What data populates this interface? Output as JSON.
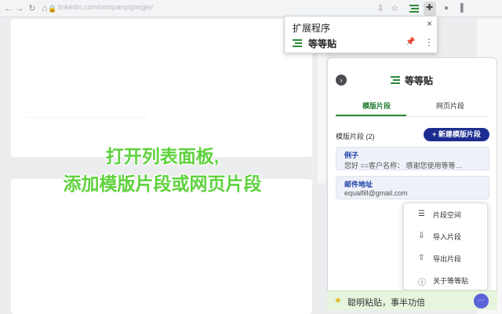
{
  "browser": {
    "url": "linkedin.com/company/google/"
  },
  "extensions_popup": {
    "title": "扩展程序",
    "extension_name": "等等贴",
    "close_glyph": "×",
    "pin_glyph": "📌",
    "more_glyph": "⋮"
  },
  "panel": {
    "brand": "等等贴",
    "back_glyph": "›",
    "tabs": [
      {
        "label": "模版片段",
        "active": true
      },
      {
        "label": "网页片段",
        "active": false
      }
    ],
    "section_label": "模版片段 (2)",
    "new_button": "+ 新建模版片段",
    "items": [
      {
        "title": "例子",
        "body": "您好 ==客户名称：  感谢您使用等等…"
      },
      {
        "title": "邮件地址",
        "body": "equalfill@gmail.com"
      }
    ],
    "menu": [
      {
        "icon": "sliders-icon",
        "glyph": "☰",
        "label": "片段空间"
      },
      {
        "icon": "import-icon",
        "glyph": "⇩",
        "label": "导入片段"
      },
      {
        "icon": "export-icon",
        "glyph": "⇧",
        "label": "导出片段"
      },
      {
        "icon": "info-icon",
        "glyph": "ⓘ",
        "label": "关于等等贴"
      }
    ],
    "footer_text": "聪明粘贴，事半功倍",
    "footer_more": "···"
  },
  "caption": {
    "line1": "打开列表面板,",
    "line2": "添加模版片段或网页片段"
  },
  "colors": {
    "brand_green": "#2f8a3a",
    "primary_navy": "#1c2d8f",
    "caption_green": "#5fd23e",
    "footer_bg": "#e7f5df",
    "fab_purple": "#5a63d8"
  }
}
